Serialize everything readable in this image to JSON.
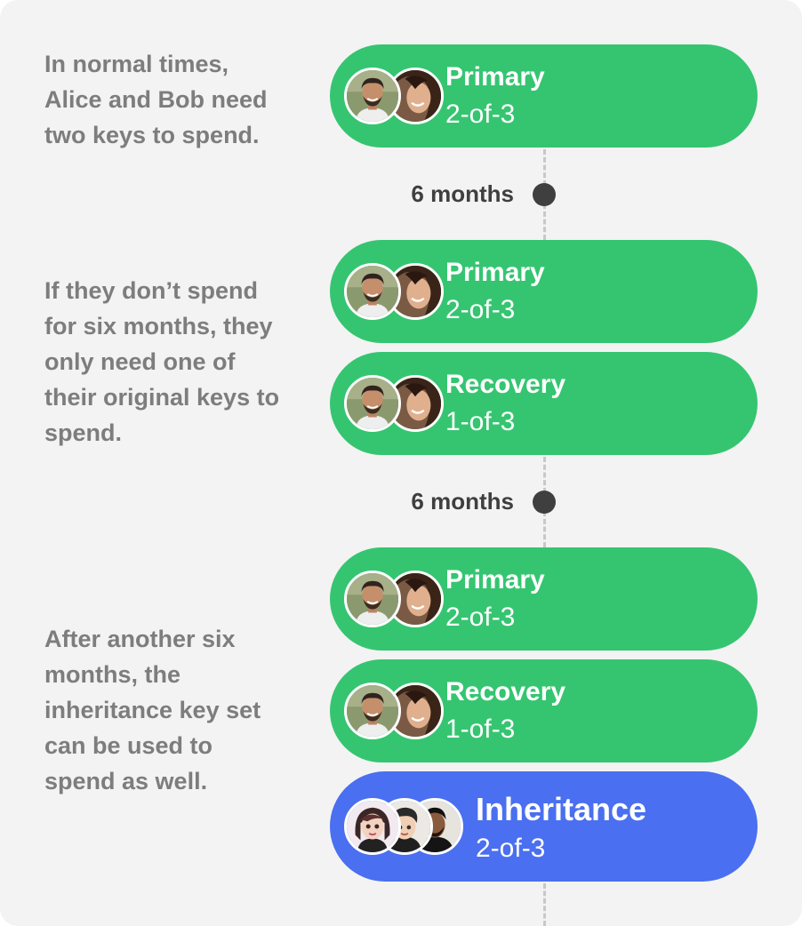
{
  "descriptions": {
    "normal": [
      "In normal times,",
      "Alice and Bob need",
      "two keys to spend."
    ],
    "after_six": [
      "If they don’t spend",
      "for six months, they",
      "only need one of",
      "their original keys to",
      "spend."
    ],
    "after_twelve": [
      "After another six",
      "months, the",
      "inheritance key set",
      "can be used to",
      "spend as well."
    ]
  },
  "intervals": [
    "6 months",
    "6 months"
  ],
  "stage1": {
    "primary": {
      "title": "Primary",
      "quorum": "2-of-3",
      "avatars": [
        "bob-avatar",
        "alice-avatar"
      ]
    }
  },
  "stage2": {
    "primary": {
      "title": "Primary",
      "quorum": "2-of-3",
      "avatars": [
        "bob-avatar",
        "alice-avatar"
      ]
    },
    "recovery": {
      "title": "Recovery",
      "quorum": "1-of-3",
      "avatars": [
        "bob-avatar",
        "alice-avatar"
      ]
    }
  },
  "stage3": {
    "primary": {
      "title": "Primary",
      "quorum": "2-of-3",
      "avatars": [
        "bob-avatar",
        "alice-avatar"
      ]
    },
    "recovery": {
      "title": "Recovery",
      "quorum": "1-of-3",
      "avatars": [
        "bob-avatar",
        "alice-avatar"
      ]
    },
    "inheritance": {
      "title": "Inheritance",
      "quorum": "2-of-3",
      "avatars": [
        "girl-heir-avatar",
        "boy-heir-avatar",
        "young-man-heir-avatar"
      ]
    }
  },
  "colors": {
    "background": "#f3f3f3",
    "green_pill": "#35c571",
    "blue_pill": "#4a6ff0",
    "description_text": "#7d7d7d",
    "timeline_dot": "#3f3f3f",
    "timeline_line": "#c8c8c8"
  }
}
